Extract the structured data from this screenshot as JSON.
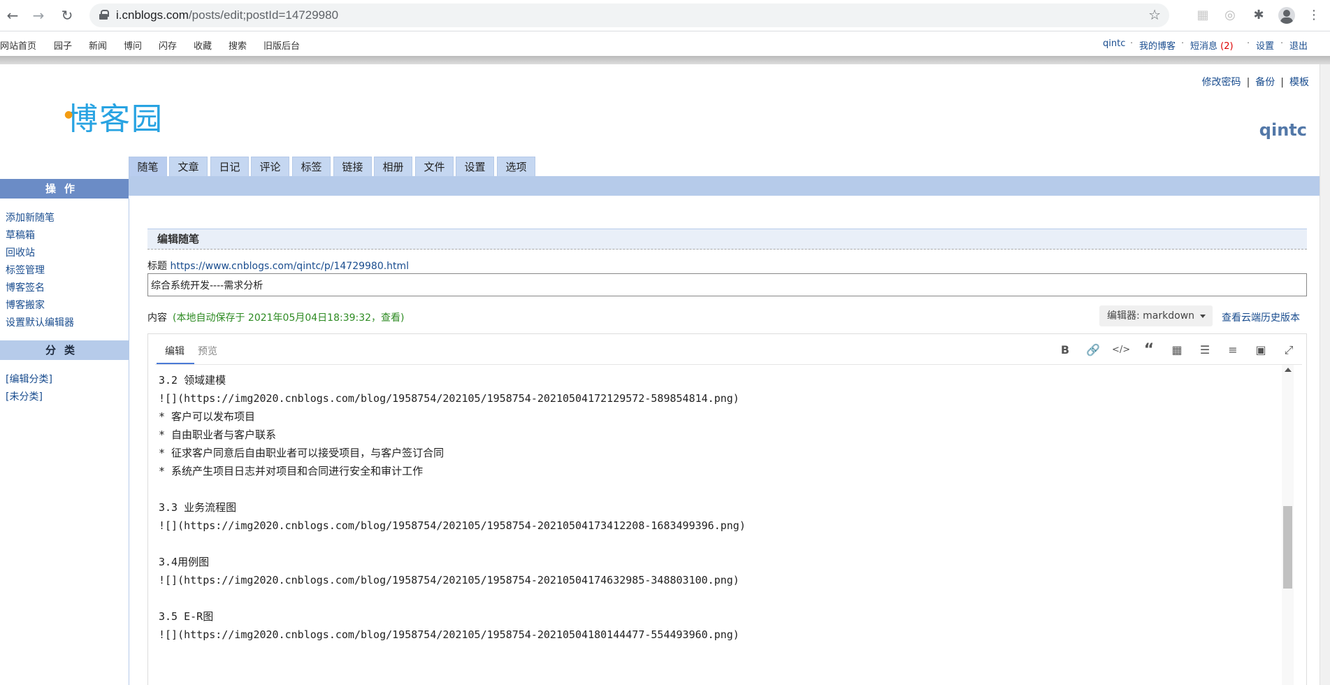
{
  "browser": {
    "url_host": "i.cnblogs.com",
    "url_path": "/posts/edit;postId=14729980",
    "icons": [
      "back-icon",
      "forward-icon",
      "reload-icon",
      "lock-icon",
      "star-icon",
      "extension-icon",
      "profile-icon",
      "more-icon"
    ]
  },
  "site_nav": {
    "left": [
      "网站首页",
      "园子",
      "新闻",
      "博问",
      "闪存",
      "收藏",
      "搜索",
      "旧版后台"
    ],
    "user": "qintc",
    "my_blog": "我的博客",
    "messages": "短消息",
    "message_count": "(2)",
    "settings": "设置",
    "logout": "退出",
    "dot": "·"
  },
  "header": {
    "logo": "博客园",
    "links": [
      "修改密码",
      "备份",
      "模板"
    ],
    "link_sep": "|",
    "blog_name": "qintc"
  },
  "tabs": [
    "随笔",
    "文章",
    "日记",
    "评论",
    "标签",
    "链接",
    "相册",
    "文件",
    "设置",
    "选项"
  ],
  "sidebar": {
    "operations_title": "操作",
    "operations": [
      "添加新随笔",
      "草稿箱",
      "回收站",
      "标签管理",
      "博客签名",
      "博客搬家",
      "设置默认编辑器"
    ],
    "categories_title": "分类",
    "categories": [
      "[编辑分类]",
      "[未分类]"
    ]
  },
  "editor": {
    "heading": "编辑随笔",
    "title_label": "标题",
    "post_url": "https://www.cnblogs.com/qintc/p/14729980.html",
    "title_value": "综合系统开发----需求分析",
    "content_label": "内容",
    "autosave_prefix": "(本地自动保存于 2021年05月04日18:39:32，",
    "autosave_view": "查看",
    "autosave_suffix": ")",
    "editor_picker": "编辑器: markdown",
    "history_link": "查看云端历史版本",
    "tab_edit": "编辑",
    "tab_preview": "预览",
    "toolbar_icons": [
      "bold-icon",
      "link-icon",
      "code-icon",
      "quote-icon",
      "table-icon",
      "bullet-list-icon",
      "numbered-list-icon",
      "image-icon",
      "fullscreen-icon"
    ],
    "lines": [
      "3.2 领域建模",
      "![](https://img2020.cnblogs.com/blog/1958754/202105/1958754-20210504172129572-589854814.png)",
      "* 客户可以发布项目",
      "* 自由职业者与客户联系",
      "* 征求客户同意后自由职业者可以接受项目，与客户签订合同",
      "* 系统产生项目日志并对项目和合同进行安全和审计工作",
      "",
      "3.3 业务流程图",
      "![](https://img2020.cnblogs.com/blog/1958754/202105/1958754-20210504173412208-1683499396.png)",
      "",
      "3.4用例图",
      "![](https://img2020.cnblogs.com/blog/1958754/202105/1958754-20210504174632985-348803100.png)",
      "",
      "3.5 E-R图",
      "![](https://img2020.cnblogs.com/blog/1958754/202105/1958754-20210504180144477-554493960.png)"
    ]
  }
}
